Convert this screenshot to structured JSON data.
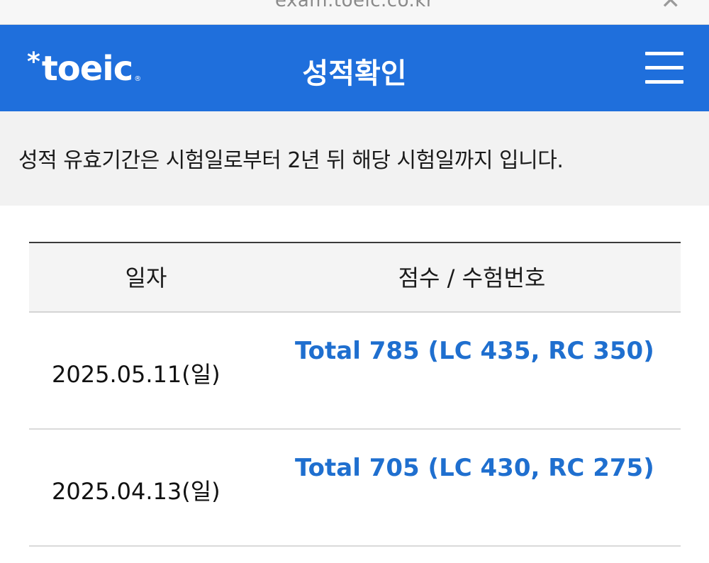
{
  "browser": {
    "url": "exam.toeic.co.kr"
  },
  "header": {
    "logo_text": "toeic",
    "title": "성적확인"
  },
  "notice": {
    "text": "성적 유효기간은 시험일로부터 2년 뒤 해당 시험일까지 입니다."
  },
  "table": {
    "headers": {
      "date": "일자",
      "score": "점수 / 수험번호"
    },
    "rows": [
      {
        "date": "2025.05.11(일)",
        "score": "Total 785 (LC 435, RC 350)"
      },
      {
        "date": "2025.04.13(일)",
        "score": "Total 705 (LC 430, RC 275)"
      }
    ]
  },
  "colors": {
    "brand": "#1f6fdc",
    "score_text": "#1f6fcf"
  },
  "icons": {
    "close": "close-icon",
    "menu": "hamburger-menu-icon"
  }
}
